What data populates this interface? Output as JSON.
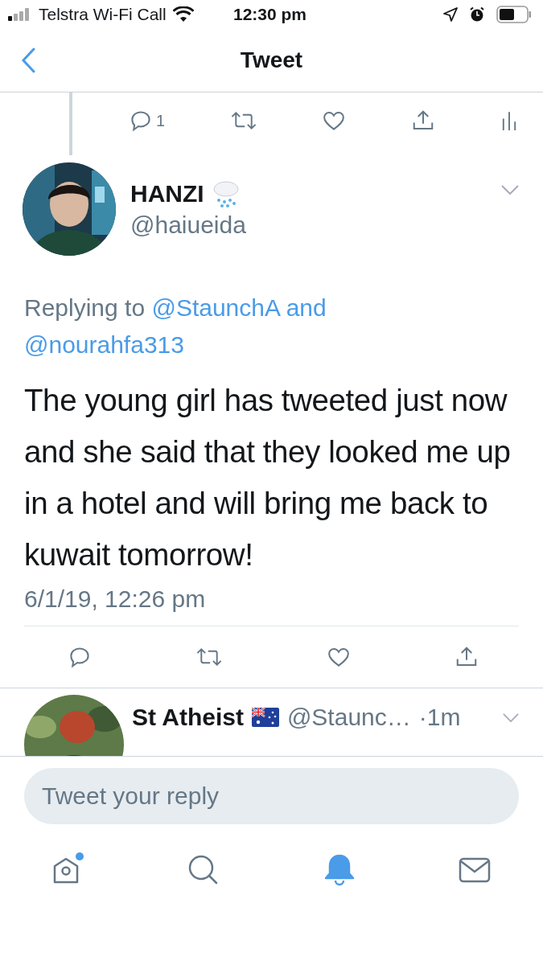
{
  "status_bar": {
    "carrier": "Telstra Wi-Fi Call",
    "time": "12:30 pm"
  },
  "nav": {
    "title": "Tweet"
  },
  "parent_actions": [
    {
      "kind": "reply",
      "count": "1"
    },
    {
      "kind": "retweet"
    },
    {
      "kind": "like"
    },
    {
      "kind": "share"
    },
    {
      "kind": "analytics"
    }
  ],
  "tweet": {
    "author": "HANZI",
    "handle": "@haiueida",
    "reply_prefix": "Replying to",
    "mentions": [
      "@StaunchA and",
      "@nourahfa313"
    ],
    "text": "The young girl has tweeted just now and she said that they looked me up in a hotel and will bring me back to kuwait tomorrow!",
    "timestamp": "6/1/19, 12:26 pm",
    "actions": [
      {
        "kind": "reply"
      },
      {
        "kind": "retweet"
      },
      {
        "kind": "like"
      },
      {
        "kind": "share"
      }
    ]
  },
  "replies": [
    {
      "name": "St Atheist",
      "handle": "@Staunc…",
      "time": "·1m"
    }
  ],
  "reply_box": {
    "placeholder": "Tweet your reply"
  },
  "tabs": [
    {
      "kind": "home",
      "selected": false,
      "badge": true
    },
    {
      "kind": "search",
      "selected": false,
      "badge": false
    },
    {
      "kind": "notifications",
      "selected": true,
      "badge": false
    },
    {
      "kind": "messages",
      "selected": false,
      "badge": false
    }
  ]
}
